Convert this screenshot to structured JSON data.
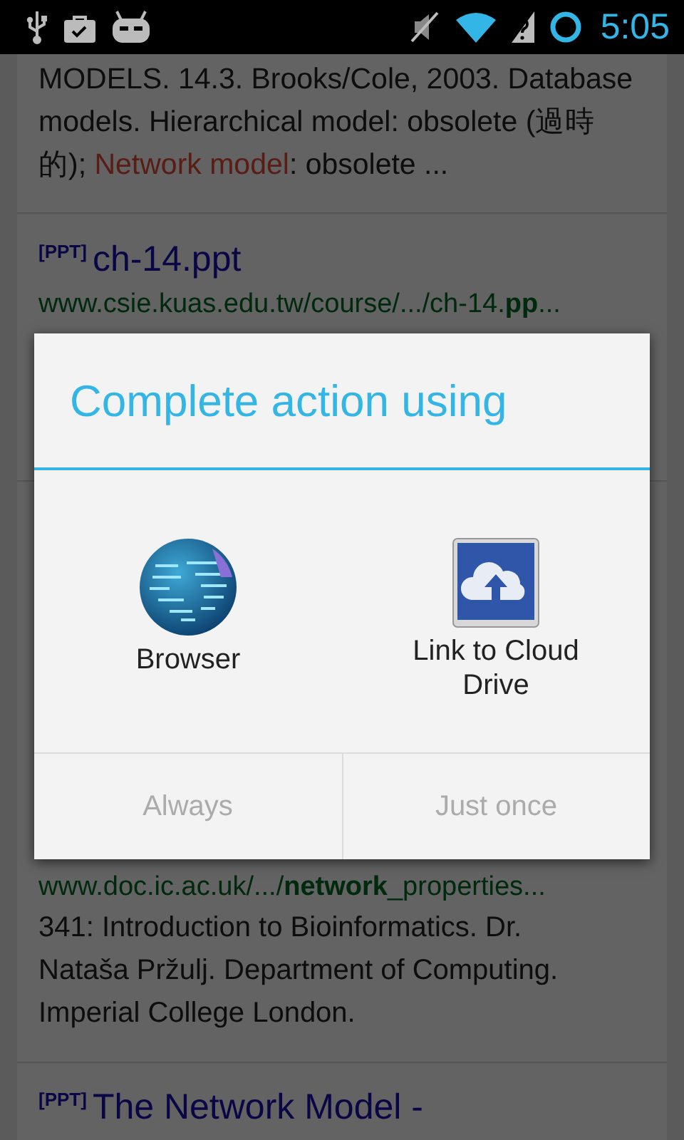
{
  "status_bar": {
    "time": "5:05"
  },
  "results": [
    {
      "snippet": [
        {
          "kind": "plain",
          "text": "MODELS. 14.3. Brooks/Cole, 2003. Database models. Hierarchical model: obsolete (過時的); "
        },
        {
          "kind": "match",
          "text": "Network model"
        },
        {
          "kind": "plain",
          "text": ": obsolete ..."
        }
      ]
    },
    {
      "tag": "[PPT]",
      "title": "ch-14.ppt",
      "url": "www.csie.kuas.edu.tw/course/.../ch-14.**pp**..."
    },
    {
      "url": "www.doc.ic.ac.uk/.../**network**_properties...",
      "snippet": [
        {
          "kind": "plain",
          "text": "341: Introduction to Bioinformatics. Dr. Nataša Pržulj. Department of Computing. Imperial College London."
        }
      ]
    },
    {
      "tag": "[PPT]",
      "title": "The Network Model -"
    }
  ],
  "dialog": {
    "title": "Complete action using",
    "apps": [
      {
        "kind": "globe",
        "label": "Browser"
      },
      {
        "kind": "cloud",
        "label": "Link to Cloud Drive"
      }
    ],
    "buttons": [
      {
        "label": "Always",
        "disabled": true
      },
      {
        "label": "Just once",
        "disabled": true
      }
    ]
  }
}
